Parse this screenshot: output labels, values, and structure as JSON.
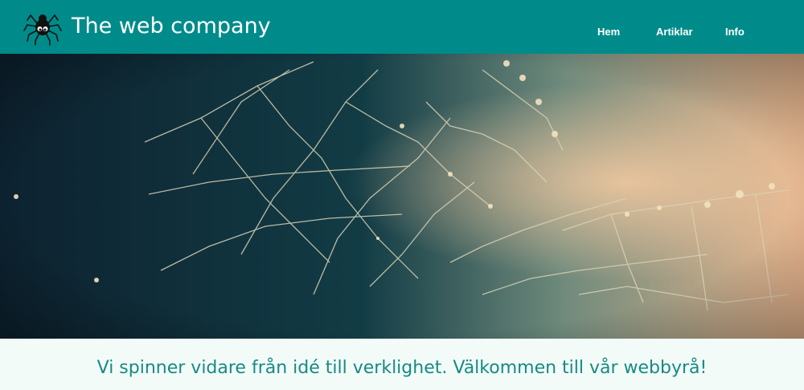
{
  "brand": {
    "title": "The web company",
    "logo_icon": "spider-icon"
  },
  "nav": {
    "items": [
      {
        "label": "Hem"
      },
      {
        "label": "Artiklar"
      },
      {
        "label": "Info"
      }
    ]
  },
  "hero": {
    "image": "spider-web-photo"
  },
  "tagline": {
    "text": "Vi spinner vidare från idé till verklighet. Välkommen till vår webbyrå!"
  },
  "colors": {
    "header_bg": "#008b8b",
    "tagline_text": "#178a83",
    "page_bg": "#f2fbf8"
  }
}
